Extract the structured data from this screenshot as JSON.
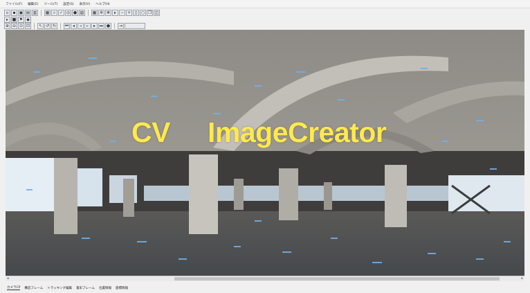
{
  "menu": {
    "items": [
      "ファイル(F)",
      "編集(E)",
      "ツール(T)",
      "設定(S)",
      "表示(V)",
      "ヘルプ(H)"
    ]
  },
  "toolbars": {
    "row1_icons": [
      "new-file-icon",
      "open-folder-icon",
      "save-icon",
      "save-all-icon",
      "export-icon",
      "window-icon",
      "search-icon",
      "check-icon",
      "target-icon",
      "color-wheel-icon",
      "image-icon",
      "grid-icon",
      "gear-icon",
      "settings-icon",
      "play-icon",
      "minus-icon",
      "plus-icon",
      "frame-icon",
      "circle-icon",
      "copy-icon",
      "layers-icon"
    ],
    "row2_icons": [
      "play-icon",
      "stop-icon",
      "flag-icon",
      "marker-icon"
    ],
    "row3_icons": [
      "zoom-in-icon",
      "zoom-out-icon",
      "zoom-fit-icon",
      "zoom-area-icon",
      "arrow-icon",
      "rotate-left-icon",
      "rotate-right-icon",
      "first-frame-icon",
      "prev-frame-icon",
      "step-back-icon",
      "step-forward-icon",
      "next-frame-icon",
      "last-frame-icon",
      "record-icon",
      "jump-icon",
      "slider-icon"
    ]
  },
  "viewer": {
    "overlay_word1": "CV",
    "overlay_word2": "ImageCreator",
    "overlay_color": "#FFE94C"
  },
  "status": {
    "tabs": [
      "カメラCP",
      "構造フレーム",
      "トラッキング編集",
      "着彩フレーム",
      "位置情報",
      "座標情報"
    ]
  }
}
